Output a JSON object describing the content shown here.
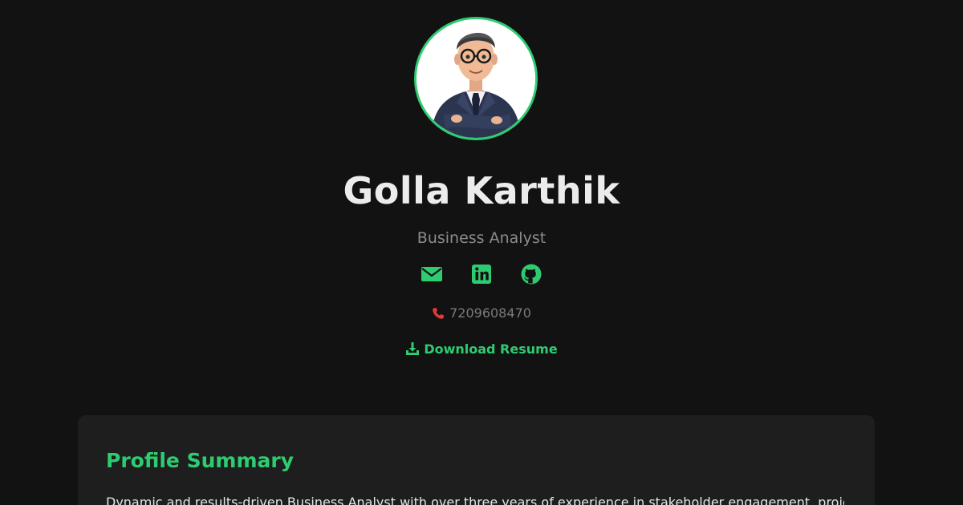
{
  "profile": {
    "name": "Golla Karthik",
    "role": "Business Analyst",
    "avatar_icon": "cartoon-businessman-avatar"
  },
  "contact": {
    "phone": "7209608470",
    "phone_icon": "phone-icon",
    "socials": [
      {
        "name": "email",
        "icon": "envelope-icon"
      },
      {
        "name": "linkedin",
        "icon": "linkedin-icon"
      },
      {
        "name": "github",
        "icon": "github-icon"
      }
    ]
  },
  "download": {
    "label": "Download Resume",
    "icon": "download-icon"
  },
  "summary": {
    "title": "Profile Summary",
    "text": "Dynamic and results-driven Business Analyst with over three years of experience in stakeholder engagement, project"
  },
  "colors": {
    "background": "#121212",
    "card": "#1e1e1e",
    "accent": "#2ecc71",
    "phone_icon": "#e53935"
  }
}
